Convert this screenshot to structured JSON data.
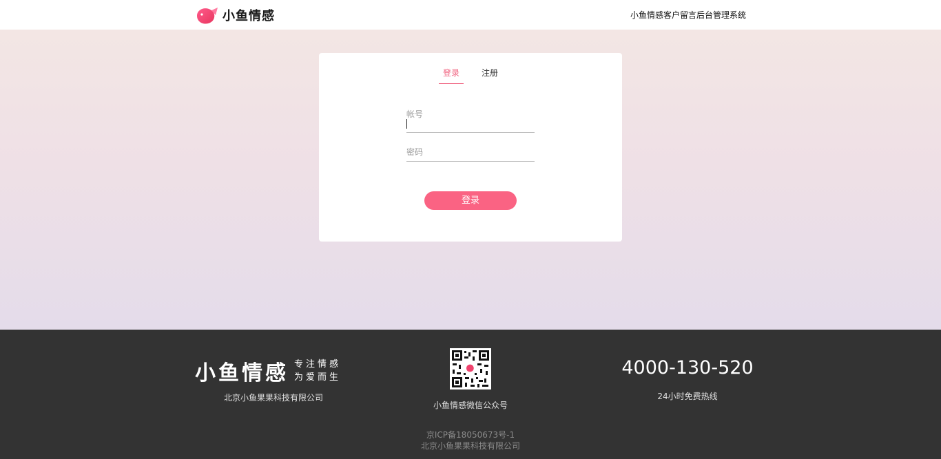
{
  "header": {
    "logo_text": "小鱼情感",
    "system_title": "小鱼情感客户留言后台管理系统"
  },
  "colors": {
    "accent": "#f0607e",
    "button": "#fa6383",
    "footer_bg": "#333333"
  },
  "login_card": {
    "tabs": [
      {
        "label": "登录",
        "active": true
      },
      {
        "label": "注册",
        "active": false
      }
    ],
    "account_label": "帐号",
    "account_value": "",
    "password_label": "密码",
    "password_value": "",
    "submit_label": "登录"
  },
  "footer": {
    "brand_name": "小鱼情感",
    "slogan_line1": "专注情感",
    "slogan_line2": "为爱而生",
    "company": "北京小鱼果果科技有限公司",
    "qr_caption": "小鱼情感微信公众号",
    "qr_icon": "qr-code-icon",
    "hotline": "4000-130-520",
    "hotline_caption": "24小时免费热线",
    "icp": "京ICP备18050673号-1",
    "copyright": "北京小鱼果果科技有限公司"
  }
}
